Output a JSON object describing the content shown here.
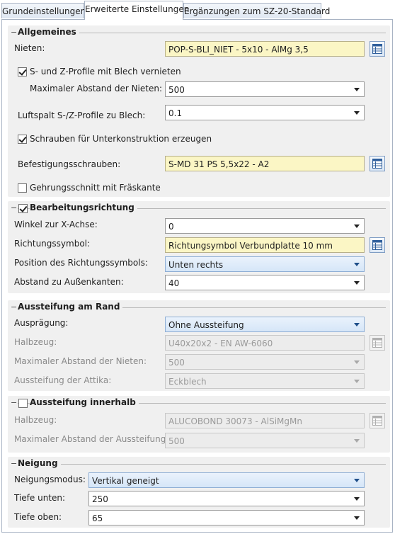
{
  "tabs": [
    "Grundeinstellungen",
    "Erweiterte Einstellungen",
    "Ergänzungen zum SZ-20-Standard"
  ],
  "allgemeines": {
    "title": "Allgemeines",
    "nieten_label": "Nieten:",
    "nieten_value": "POP-S-BLI_NIET -  5x10 - AlMg 3,5",
    "sz_vernieten_label": "S- und Z-Profile mit Blech vernieten",
    "sz_vernieten_checked": true,
    "max_abstand_label": "Maximaler Abstand der Nieten:",
    "max_abstand_value": "500",
    "luftspalt_label": "Luftspalt S-/Z-Profile zu Blech:",
    "luftspalt_value": "0.1",
    "schrauben_label": "Schrauben für Unterkonstruktion erzeugen",
    "schrauben_checked": true,
    "befestigung_label": "Befestigungsschrauben:",
    "befestigung_value": "S-MD 31 PS 5,5x22 - A2",
    "gehrung_label": "Gehrungsschnitt mit Fräskante",
    "gehrung_checked": false
  },
  "bearbeitung": {
    "title": "Bearbeitungsrichtung",
    "checked": true,
    "winkel_label": "Winkel zur X-Achse:",
    "winkel_value": "0",
    "symbol_label": "Richtungssymbol:",
    "symbol_value": "Richtungsymbol Verbundplatte 10 mm",
    "position_label": "Position des Richtungssymbols:",
    "position_value": "Unten rechts",
    "abstand_label": "Abstand zu Außenkanten:",
    "abstand_value": "40"
  },
  "aussteifung_rand": {
    "title": "Aussteifung am Rand",
    "auspraegung_label": "Ausprägung:",
    "auspraegung_value": "Ohne Aussteifung",
    "halbzeug_label": "Halbzeug:",
    "halbzeug_value": "U40x20x2 - EN AW-6060",
    "max_abstand_label": "Maximaler Abstand der Nieten:",
    "max_abstand_value": "500",
    "attika_label": "Aussteifung der Attika:",
    "attika_value": "Eckblech"
  },
  "aussteifung_innen": {
    "title": "Aussteifung innerhalb",
    "checked": false,
    "halbzeug_label": "Halbzeug:",
    "halbzeug_value": "ALUCOBOND 30073 - AlSiMgMn",
    "max_abstand_label": "Maximaler Abstand der Aussteifungen:",
    "max_abstand_value": "500"
  },
  "neigung": {
    "title": "Neigung",
    "modus_label": "Neigungsmodus: :",
    "modus_value": "Vertikal geneigt",
    "tiefe_unten_label": "Tiefe unten:",
    "tiefe_unten_value": "250",
    "tiefe_oben_label": "Tiefe oben:",
    "tiefe_oben_value": "65"
  }
}
